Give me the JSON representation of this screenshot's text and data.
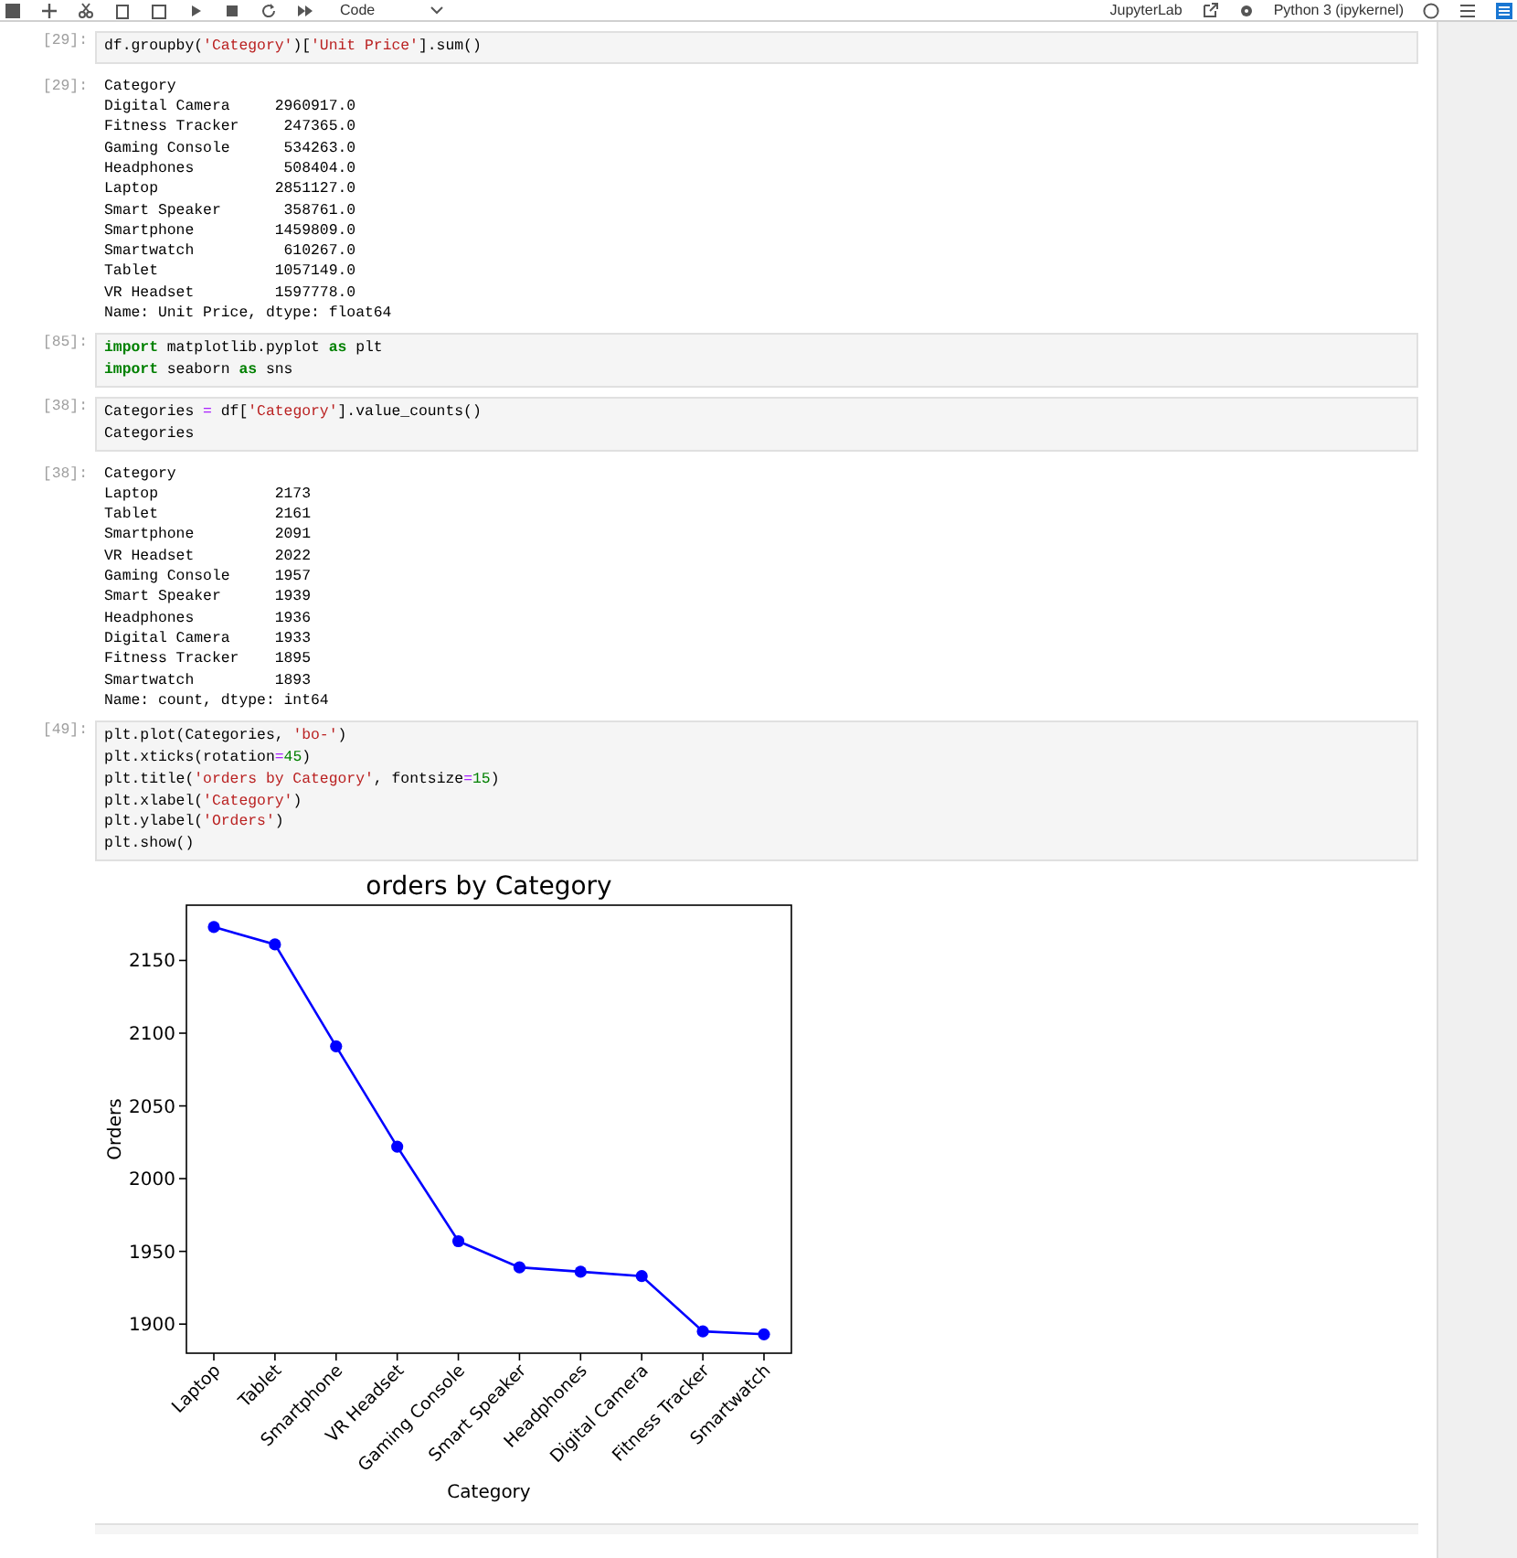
{
  "toolbar": {
    "cell_type": "Code",
    "app_link": "JupyterLab",
    "kernel": "Python 3 (ipykernel)"
  },
  "cells": [
    {
      "kind": "input",
      "prompt": "[29]:",
      "lines": [
        [
          {
            "t": "df.groupby(",
            "kind": "name"
          },
          {
            "t": "'Category'",
            "kind": "string"
          },
          {
            "t": ")[",
            "kind": "name"
          },
          {
            "t": "'Unit Price'",
            "kind": "string"
          },
          {
            "t": "].sum()",
            "kind": "name"
          }
        ]
      ]
    },
    {
      "kind": "output",
      "prompt": "[29]:",
      "lines": [
        "Category",
        "Digital Camera     2960917.0",
        "Fitness Tracker     247365.0",
        "Gaming Console      534263.0",
        "Headphones          508404.0",
        "Laptop             2851127.0",
        "Smart Speaker       358761.0",
        "Smartphone         1459809.0",
        "Smartwatch          610267.0",
        "Tablet             1057149.0",
        "VR Headset         1597778.0",
        "Name: Unit Price, dtype: float64"
      ]
    },
    {
      "kind": "input",
      "prompt": "[85]:",
      "lines": [
        [
          {
            "t": "import",
            "kind": "keyword"
          },
          {
            "t": " matplotlib.pyplot ",
            "kind": "name"
          },
          {
            "t": "as",
            "kind": "keyword"
          },
          {
            "t": " plt",
            "kind": "name"
          }
        ],
        [
          {
            "t": "import",
            "kind": "keyword"
          },
          {
            "t": " seaborn ",
            "kind": "name"
          },
          {
            "t": "as",
            "kind": "keyword"
          },
          {
            "t": " sns",
            "kind": "name"
          }
        ]
      ]
    },
    {
      "kind": "input",
      "prompt": "[38]:",
      "lines": [
        [
          {
            "t": "Categories ",
            "kind": "name"
          },
          {
            "t": "=",
            "kind": "operator"
          },
          {
            "t": " df[",
            "kind": "name"
          },
          {
            "t": "'Category'",
            "kind": "string"
          },
          {
            "t": "].value_counts()",
            "kind": "name"
          }
        ],
        [
          {
            "t": "Categories",
            "kind": "name"
          }
        ]
      ]
    },
    {
      "kind": "output",
      "prompt": "[38]:",
      "lines": [
        "Category",
        "Laptop             2173",
        "Tablet             2161",
        "Smartphone         2091",
        "VR Headset         2022",
        "Gaming Console     1957",
        "Smart Speaker      1939",
        "Headphones         1936",
        "Digital Camera     1933",
        "Fitness Tracker    1895",
        "Smartwatch         1893",
        "Name: count, dtype: int64"
      ]
    },
    {
      "kind": "input",
      "prompt": "[49]:",
      "lines": [
        [
          {
            "t": "plt.plot(Categories, ",
            "kind": "name"
          },
          {
            "t": "'bo-'",
            "kind": "string"
          },
          {
            "t": ")",
            "kind": "name"
          }
        ],
        [
          {
            "t": "plt.xticks(rotation",
            "kind": "name"
          },
          {
            "t": "=",
            "kind": "operator"
          },
          {
            "t": "45",
            "kind": "number"
          },
          {
            "t": ")",
            "kind": "name"
          }
        ],
        [
          {
            "t": "plt.title(",
            "kind": "name"
          },
          {
            "t": "'orders by Category'",
            "kind": "string"
          },
          {
            "t": ", fontsize",
            "kind": "name"
          },
          {
            "t": "=",
            "kind": "operator"
          },
          {
            "t": "15",
            "kind": "number"
          },
          {
            "t": ")",
            "kind": "name"
          }
        ],
        [
          {
            "t": "plt.xlabel(",
            "kind": "name"
          },
          {
            "t": "'Category'",
            "kind": "string"
          },
          {
            "t": ")",
            "kind": "name"
          }
        ],
        [
          {
            "t": "plt.ylabel(",
            "kind": "name"
          },
          {
            "t": "'Orders'",
            "kind": "string"
          },
          {
            "t": ")",
            "kind": "name"
          }
        ],
        [
          {
            "t": "plt.show()",
            "kind": "name"
          }
        ]
      ]
    },
    {
      "kind": "chart",
      "chart_data": {
        "type": "line",
        "title": "orders by Category",
        "xlabel": "Category",
        "ylabel": "Orders",
        "categories": [
          "Laptop",
          "Tablet",
          "Smartphone",
          "VR Headset",
          "Gaming Console",
          "Smart Speaker",
          "Headphones",
          "Digital Camera",
          "Fitness Tracker",
          "Smartwatch"
        ],
        "series": [
          {
            "color": "#0000ff",
            "marker": "o",
            "values": [
              2173,
              2161,
              2091,
              2022,
              1957,
              1939,
              1936,
              1933,
              1895,
              1893
            ]
          }
        ],
        "ylim": [
          1880,
          2188
        ],
        "yticks": [
          1900,
          1950,
          2000,
          2050,
          2100,
          2150
        ]
      }
    }
  ]
}
